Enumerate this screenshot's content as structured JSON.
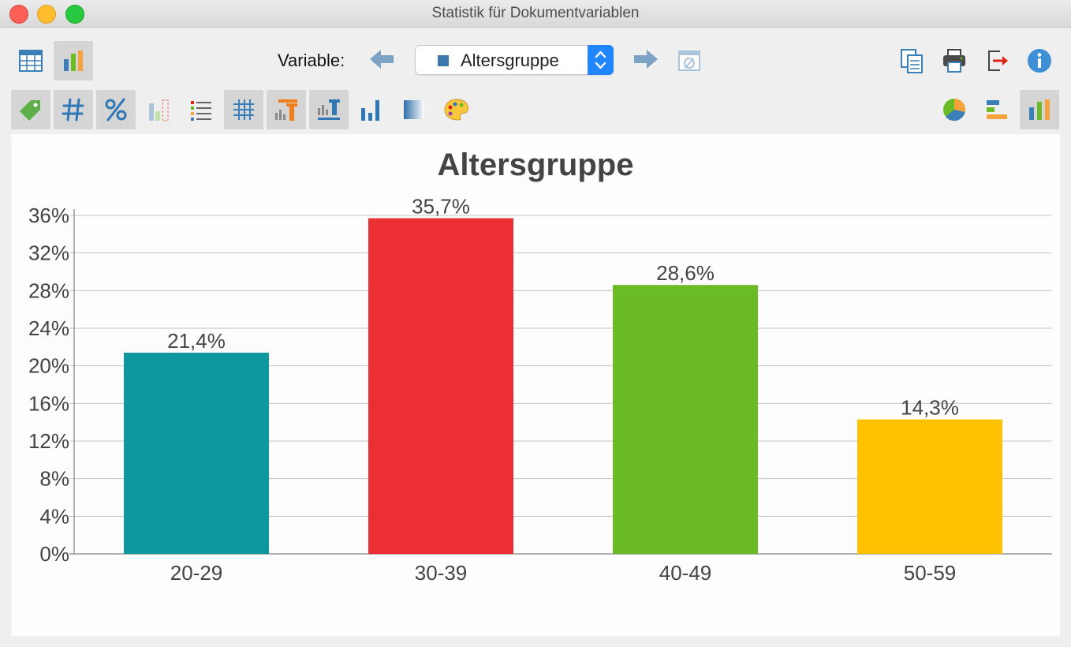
{
  "window": {
    "title": "Statistik für Dokumentvariablen"
  },
  "toolbar": {
    "variable_label": "Variable:",
    "selected_variable": "Altersgruppe",
    "icons": [
      "table-icon",
      "bar-chart-icon",
      "arrow-left-icon",
      "arrow-right-icon",
      "missing-values-icon",
      "copy-icon",
      "print-icon",
      "export-icon",
      "info-icon"
    ]
  },
  "toolbar2": {
    "icons": [
      "tag-icon",
      "hash-icon",
      "percent-icon",
      "bar-missing-icon",
      "list-icon",
      "grid-icon",
      "chart-title-icon",
      "chart-label-icon",
      "bar-chart-small-icon",
      "gradient-icon",
      "palette-icon",
      "pie-chart-icon",
      "horizontal-bar-icon",
      "vertical-bar-icon"
    ]
  },
  "chart_data": {
    "type": "bar",
    "title": "Altersgruppe",
    "categories": [
      "20-29",
      "30-39",
      "40-49",
      "50-59"
    ],
    "values": [
      21.4,
      35.7,
      28.6,
      14.3
    ],
    "value_labels": [
      "21,4%",
      "35,7%",
      "28,6%",
      "14,3%"
    ],
    "bar_colors": [
      "#0e979f",
      "#eb2f33",
      "#6abb25",
      "#ffc100"
    ],
    "ylim": [
      0,
      36
    ],
    "yticks": [
      0,
      4,
      8,
      12,
      16,
      20,
      24,
      28,
      32,
      36
    ],
    "ytick_labels": [
      "0%",
      "4%",
      "8%",
      "12%",
      "16%",
      "20%",
      "24%",
      "28%",
      "32%",
      "36%"
    ],
    "grid": true,
    "xlabel": "",
    "ylabel": ""
  }
}
